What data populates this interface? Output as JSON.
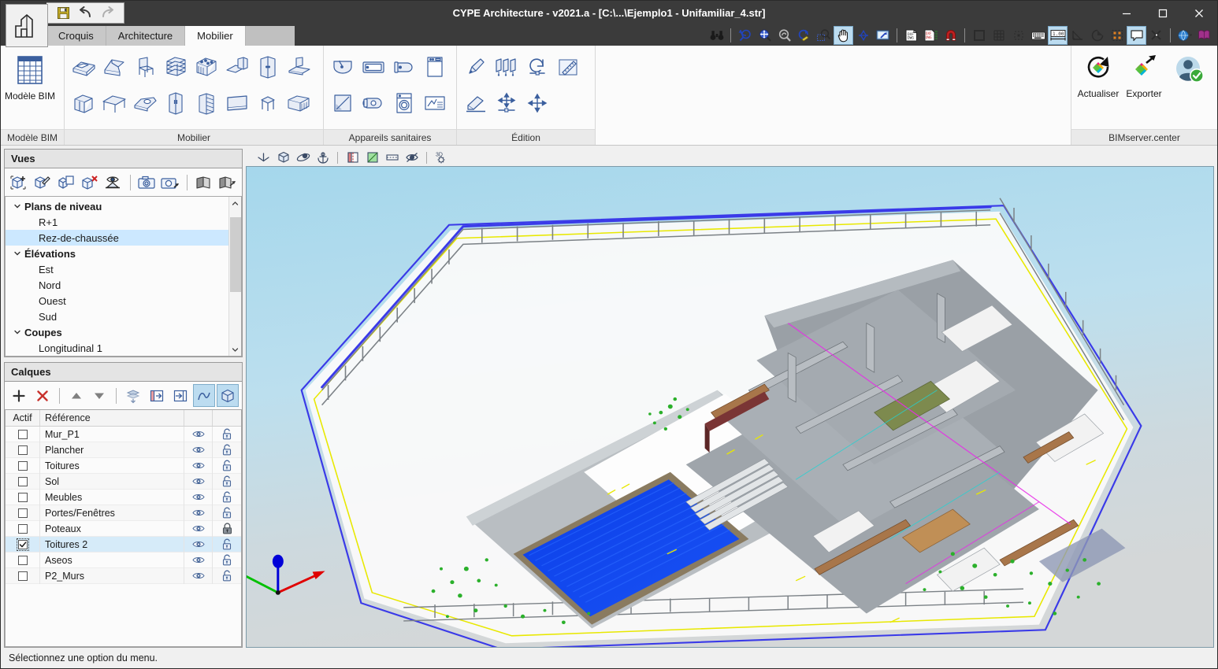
{
  "titlebar": {
    "title": "CYPE Architecture - v2021.a - [C:\\...\\Ejemplo1 - Unifamiliar_4.str]",
    "app_icon": "cype-building-icon",
    "quick_access": [
      {
        "name": "save-icon",
        "label": "Enregistrer"
      },
      {
        "name": "undo-icon",
        "label": "Annuler"
      },
      {
        "name": "redo-icon",
        "label": "Rétablir"
      }
    ],
    "minimize": "–",
    "maximize": "☐",
    "close": "✕"
  },
  "tabs": [
    {
      "label": "Croquis",
      "active": false
    },
    {
      "label": "Architecture",
      "active": false
    },
    {
      "label": "Mobilier",
      "active": true
    }
  ],
  "toptools": [
    {
      "name": "binoculars-icon",
      "active": false
    },
    {
      "name": "zoom-previous-icon",
      "active": false
    },
    {
      "name": "zoom-all-icon",
      "active": false
    },
    {
      "name": "zoom-disabled-icon",
      "active": false
    },
    {
      "name": "redraw-icon",
      "active": false
    },
    {
      "name": "zoom-window-icon",
      "active": false
    },
    {
      "name": "pan-hand-icon",
      "active": true
    },
    {
      "name": "orbit-icon",
      "active": false
    },
    {
      "name": "print-view-icon",
      "active": false
    },
    {
      "name": "dxf-dwg-import-icon",
      "active": false
    },
    {
      "name": "dxf-dwg-manage-icon",
      "active": false
    },
    {
      "name": "magnet-snap-icon",
      "active": false
    },
    {
      "name": "ortho-square-icon",
      "active": false
    },
    {
      "name": "grid-icon",
      "active": false
    },
    {
      "name": "snap-point-icon",
      "active": false
    },
    {
      "name": "keyboard-entry-icon",
      "active": false
    },
    {
      "name": "scale-100-icon",
      "active": true
    },
    {
      "name": "angle-icon",
      "active": false
    },
    {
      "name": "arc-icon",
      "active": false
    },
    {
      "name": "selection-box-icon",
      "active": false
    },
    {
      "name": "comment-icon",
      "active": true
    },
    {
      "name": "tools-icon",
      "active": false
    },
    {
      "name": "globe-icon",
      "active": false
    },
    {
      "name": "help-book-icon",
      "active": false
    }
  ],
  "ribbon": {
    "groups": [
      {
        "label": "Modèle BIM",
        "type": "big",
        "buttons": [
          {
            "name": "bim-model-icon",
            "label": "Modèle BIM"
          }
        ]
      },
      {
        "label": "Mobilier",
        "type": "grid",
        "icons": [
          "bed-double-icon",
          "sofa-icon",
          "chair-icon",
          "shelving-icon",
          "kitchen-unit-icon",
          "desk-pc-icon",
          "wardrobe-icon",
          "range-hood-icon",
          "cabinet-icon",
          "table-icon",
          "sofa-chaise-icon",
          "fridge-icon",
          "drawers-icon",
          "tv-screen-icon",
          "stool-icon",
          "sideboard-icon"
        ]
      },
      {
        "label": "Appareils sanitaires",
        "type": "grid",
        "icons": [
          "sink-basin-icon",
          "bathtub-icon",
          "toilet-icon",
          "dishwasher-icon",
          "shower-tray-icon",
          "bidet-icon",
          "washing-machine-icon",
          "water-heater-icon"
        ]
      },
      {
        "label": "Édition",
        "type": "grid",
        "icons": [
          "edit-pencil-icon",
          "copy-multiple-icon",
          "rotate-icon",
          "measure-ruler-icon",
          "erase-icon",
          "move-axis-icon",
          "move-free-icon"
        ]
      },
      {
        "label": "BIMserver.center",
        "type": "bim",
        "buttons": [
          {
            "name": "refresh-bim-icon",
            "label": "Actualiser"
          },
          {
            "name": "export-bim-icon",
            "label": "Exporter"
          },
          {
            "name": "user-account-icon",
            "label": ""
          }
        ]
      }
    ]
  },
  "vues_panel": {
    "title": "Vues",
    "tools": [
      {
        "name": "add-view-icon"
      },
      {
        "name": "edit-view-icon"
      },
      {
        "name": "copy-view-icon"
      },
      {
        "name": "delete-view-icon"
      },
      {
        "name": "view-visibility-icon"
      },
      {
        "name": "capture-icon"
      },
      {
        "name": "export-capture-icon"
      },
      {
        "name": "book-icon"
      },
      {
        "name": "export-book-icon"
      }
    ],
    "tree": [
      {
        "label": "Plans de niveau",
        "type": "group",
        "expanded": true,
        "selected": false
      },
      {
        "label": "R+1",
        "type": "child",
        "selected": false
      },
      {
        "label": "Rez-de-chaussée",
        "type": "child",
        "selected": true
      },
      {
        "label": "Élévations",
        "type": "group",
        "expanded": true,
        "selected": false
      },
      {
        "label": "Est",
        "type": "child",
        "selected": false
      },
      {
        "label": "Nord",
        "type": "child",
        "selected": false
      },
      {
        "label": "Ouest",
        "type": "child",
        "selected": false
      },
      {
        "label": "Sud",
        "type": "child",
        "selected": false
      },
      {
        "label": "Coupes",
        "type": "group",
        "expanded": true,
        "selected": false
      },
      {
        "label": "Longitudinal 1",
        "type": "child",
        "selected": false
      }
    ]
  },
  "calques_panel": {
    "title": "Calques",
    "tools": [
      {
        "name": "add-layer-icon",
        "glyph": "+",
        "color": "#333333"
      },
      {
        "name": "delete-layer-icon",
        "glyph": "✕",
        "color": "#c8322d"
      },
      {
        "name": "move-up-icon",
        "glyph": "▲",
        "color": "#707070"
      },
      {
        "name": "move-down-icon",
        "glyph": "▼",
        "color": "#707070"
      },
      {
        "name": "flatten-layers-icon"
      },
      {
        "name": "layer-left-icon"
      },
      {
        "name": "layer-right-icon"
      },
      {
        "name": "curve-snap-icon",
        "active": true
      },
      {
        "name": "solid-view-icon",
        "active": true
      }
    ],
    "columns": [
      "Actif",
      "Référence",
      "",
      ""
    ],
    "rows": [
      {
        "active": false,
        "reference": "Mur_P1",
        "visible": true,
        "locked": false,
        "selected": false
      },
      {
        "active": false,
        "reference": "Plancher",
        "visible": true,
        "locked": false,
        "selected": false
      },
      {
        "active": false,
        "reference": "Toitures",
        "visible": true,
        "locked": false,
        "selected": false
      },
      {
        "active": false,
        "reference": "Sol",
        "visible": true,
        "locked": false,
        "selected": false
      },
      {
        "active": false,
        "reference": "Meubles",
        "visible": true,
        "locked": false,
        "selected": false
      },
      {
        "active": false,
        "reference": "Portes/Fenêtres",
        "visible": true,
        "locked": false,
        "selected": false
      },
      {
        "active": false,
        "reference": "Poteaux",
        "visible": true,
        "locked": true,
        "selected": false
      },
      {
        "active": true,
        "reference": "Toitures 2",
        "visible": true,
        "locked": false,
        "selected": true
      },
      {
        "active": false,
        "reference": "Aseos",
        "visible": true,
        "locked": false,
        "selected": false
      },
      {
        "active": false,
        "reference": "P2_Murs",
        "visible": true,
        "locked": false,
        "selected": false
      }
    ]
  },
  "viewport_tools": [
    {
      "name": "axes-icon"
    },
    {
      "name": "box-icon"
    },
    {
      "name": "orbit-view-icon"
    },
    {
      "name": "anchor-icon"
    },
    {
      "name": "section-red-icon"
    },
    {
      "name": "shade-green-icon"
    },
    {
      "name": "clip-plane-icon"
    },
    {
      "name": "hide-eye-icon"
    },
    {
      "name": "3d-settings-icon"
    }
  ],
  "viewport": {
    "axis_gizmo": {
      "x_color": "#e00000",
      "y_color": "#00c000",
      "z_color": "#0000d8"
    },
    "sky_top": "#a8d8ec",
    "ground": "#d3d7d9",
    "pool_color": "#0b3fe8",
    "site_outline_yellow": "#e8e800",
    "site_outline_blue": "#3a3ae8",
    "roof_gray": "#9aa0a6"
  },
  "statusbar": {
    "message": "Sélectionnez une option du menu."
  }
}
